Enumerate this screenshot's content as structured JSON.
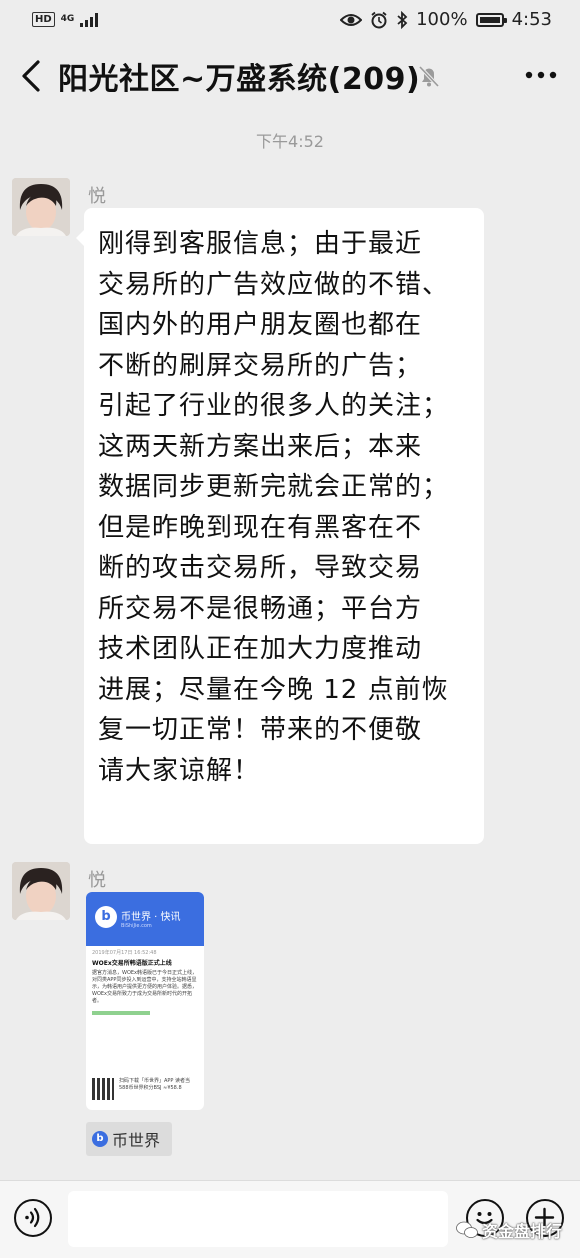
{
  "status_bar": {
    "hd": "HD",
    "network": "4G",
    "battery": "100%",
    "battery_level": 1.0,
    "clock": "4:53"
  },
  "header": {
    "title": "阳光社区~万盛系统(209)"
  },
  "timestamp": "下午4:52",
  "messages": [
    {
      "sender": "悦",
      "lines": [
        "刚得到客服信息；由于最近",
        "交易所的广告效应做的不错、",
        "国内外的用户朋友圈也都在",
        "不断的刷屏交易所的广告；",
        "引起了行业的很多人的关注；",
        "这两天新方案出来后；本来",
        "数据同步更新完就会正常的；",
        "但是昨晚到现在有黑客在不",
        "断的攻击交易所，导致交易",
        "所交易不是很畅通；平台方",
        "技术团队正在加大力度推动",
        "进展；尽量在今晚 12 点前恢",
        "复一切正常！带来的不便敬",
        "请大家谅解！"
      ]
    },
    {
      "sender": "悦",
      "card": {
        "logo": "b",
        "brand": "币世界 · 快讯",
        "site": "BiShiJie.com",
        "date": "2019年07月17日 16:52:48",
        "headline": "WOEx交易所韩语版正式上线",
        "body": "据官方消息，WOEx韩语版已于今日正式上线，对同类APP同步投入到运营中，支持全站韩语显示，为韩语用户提供更方便的用户体验。据悉，WOEx交易所致力于成为交易所新时代的开拓者。",
        "footer": "扫码下载「币世界」APP 读者当588币世界积分BSJ ≈¥58.8"
      },
      "source": {
        "logo": "b",
        "name": "币世界"
      }
    }
  ],
  "watermark": "资金盘排行"
}
